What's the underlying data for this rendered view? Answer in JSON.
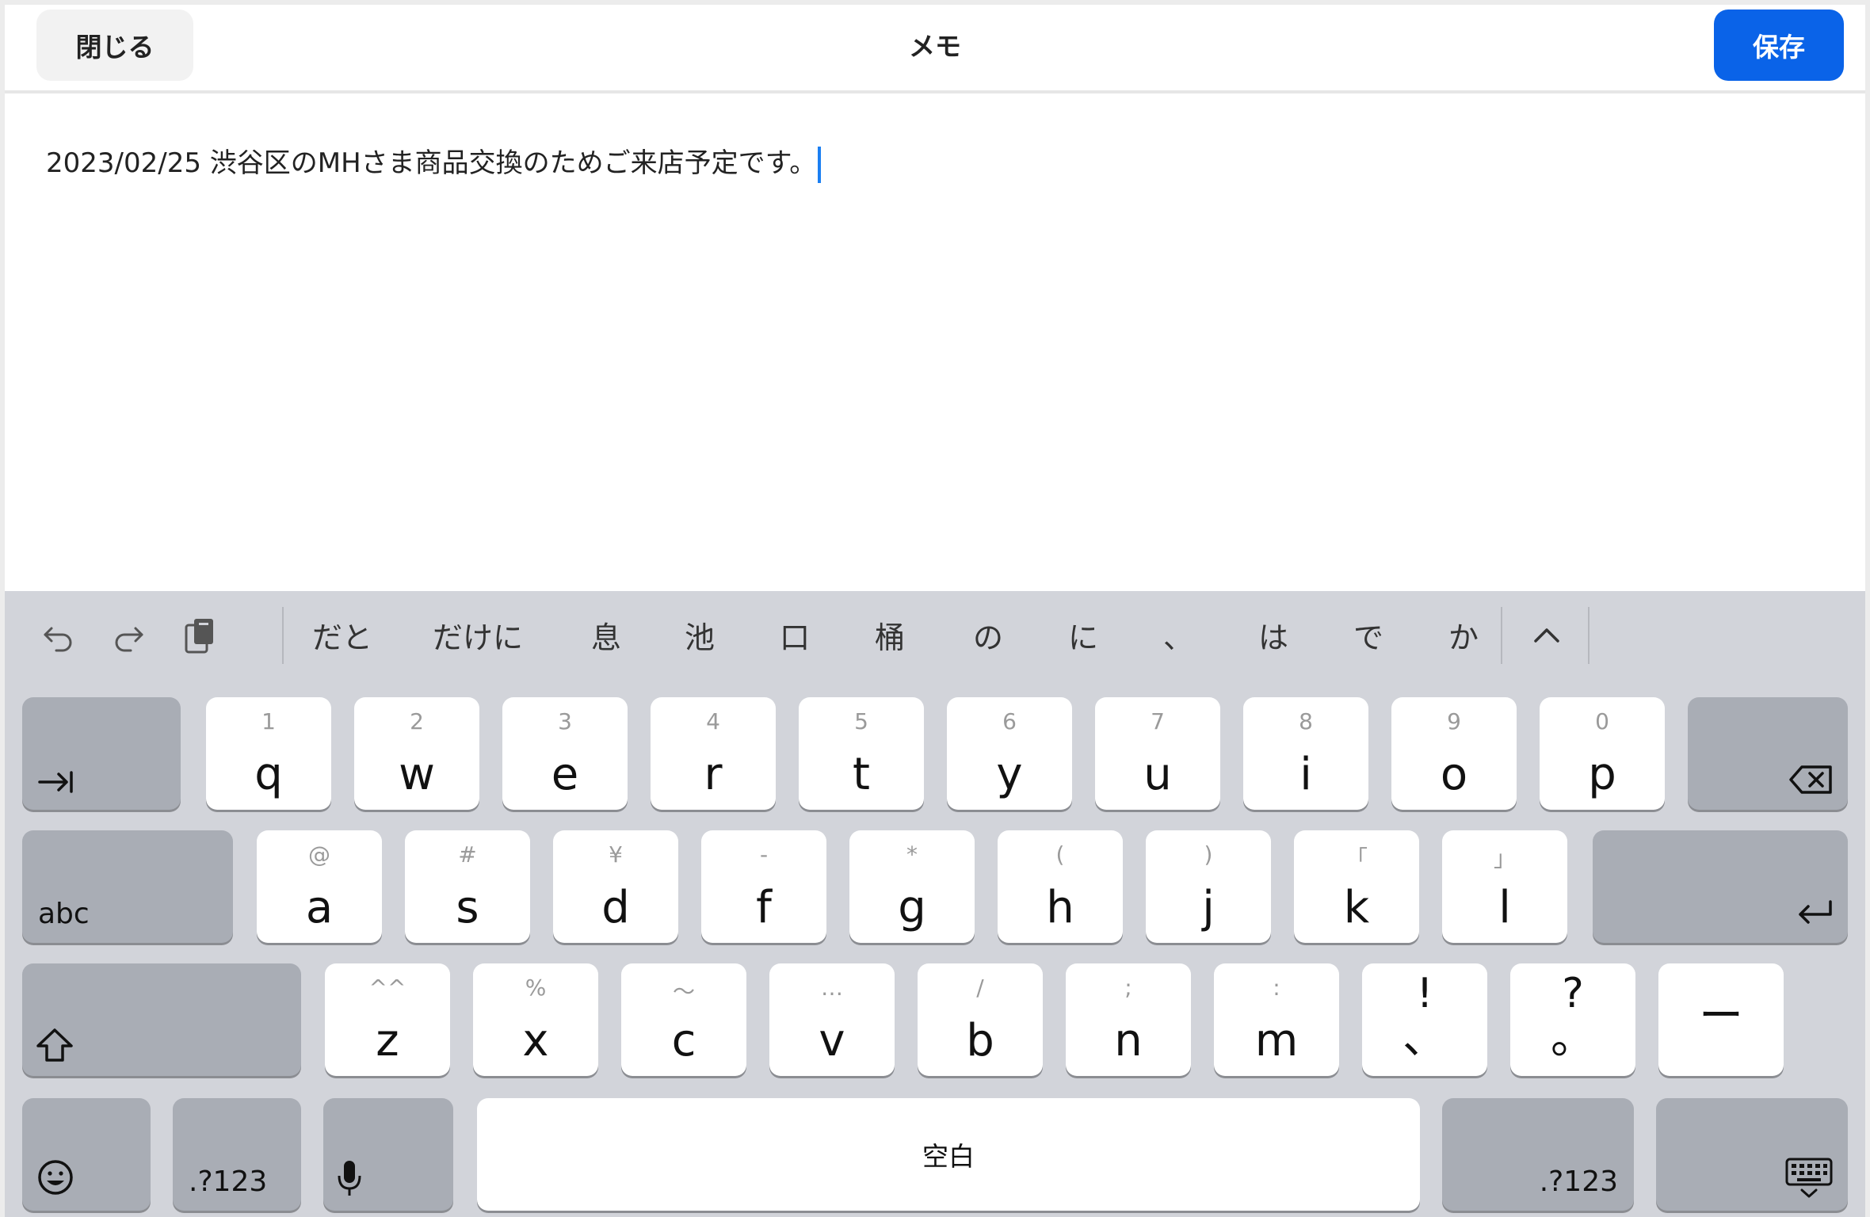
{
  "header": {
    "close_label": "閉じる",
    "title": "メモ",
    "save_label": "保存"
  },
  "memo": {
    "text": "2023/02/25  渋谷区のMHさま商品交換のためご来店予定です。"
  },
  "keyboard": {
    "candidates": [
      "だと",
      "だけに",
      "息",
      "池",
      "口",
      "桶",
      "の",
      "に",
      "、",
      "は",
      "で",
      "か"
    ],
    "tools": [
      "undo-icon",
      "redo-icon",
      "clipboard-icon",
      "chevron-up-icon"
    ],
    "row1": [
      {
        "sub": "1",
        "main": "q"
      },
      {
        "sub": "2",
        "main": "w"
      },
      {
        "sub": "3",
        "main": "e"
      },
      {
        "sub": "4",
        "main": "r"
      },
      {
        "sub": "5",
        "main": "t"
      },
      {
        "sub": "6",
        "main": "y"
      },
      {
        "sub": "7",
        "main": "u"
      },
      {
        "sub": "8",
        "main": "i"
      },
      {
        "sub": "9",
        "main": "o"
      },
      {
        "sub": "0",
        "main": "p"
      }
    ],
    "row2": [
      {
        "sub": "@",
        "main": "a"
      },
      {
        "sub": "#",
        "main": "s"
      },
      {
        "sub": "¥",
        "main": "d"
      },
      {
        "sub": "-",
        "main": "f"
      },
      {
        "sub": "*",
        "main": "g"
      },
      {
        "sub": "(",
        "main": "h"
      },
      {
        "sub": ")",
        "main": "j"
      },
      {
        "sub": "「",
        "main": "k"
      },
      {
        "sub": "」",
        "main": "l"
      }
    ],
    "row3": [
      {
        "sub": "^^",
        "main": "z"
      },
      {
        "sub": "%",
        "main": "x"
      },
      {
        "sub": "〜",
        "main": "c"
      },
      {
        "sub": "…",
        "main": "v"
      },
      {
        "sub": "/",
        "main": "b"
      },
      {
        "sub": ";",
        "main": "n"
      },
      {
        "sub": ":",
        "main": "m"
      },
      {
        "sub": "!",
        "main": "、"
      },
      {
        "sub": "?",
        "main": "。"
      },
      {
        "sub": "",
        "main": "ー"
      }
    ],
    "abc_label": "abc",
    "numbers_label": ".?123",
    "space_label": "空白"
  }
}
